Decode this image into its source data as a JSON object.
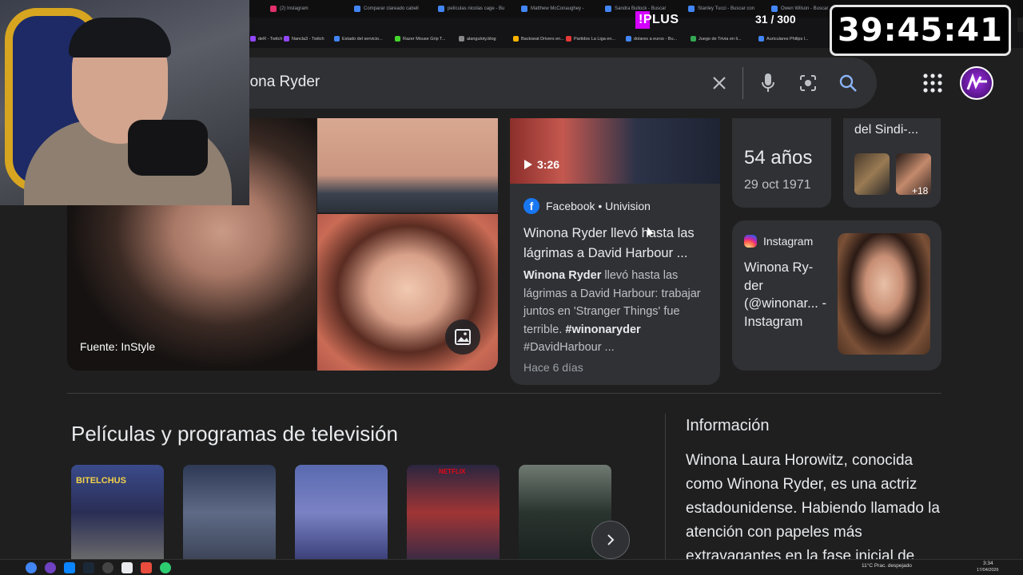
{
  "browser": {
    "tabs": [
      {
        "label": "(2) Instagram",
        "color": "#e1306c"
      },
      {
        "label": "Comparar clareado cabell",
        "color": "#4285f4"
      },
      {
        "label": "películas nicolas cage - Bu",
        "color": "#4285f4"
      },
      {
        "label": "Matthew McConaughey -",
        "color": "#4285f4"
      },
      {
        "label": "Sandra Bullock - Buscar",
        "color": "#4285f4"
      },
      {
        "label": "Stanley Tucci - Buscar con",
        "color": "#4285f4"
      },
      {
        "label": "Owen Wilson - Buscar",
        "color": "#4285f4"
      }
    ],
    "bookmarks": [
      {
        "label": "deR - Twitch",
        "color": "#9146ff"
      },
      {
        "label": "Nancla3 - Twitch",
        "color": "#9146ff"
      },
      {
        "label": "Estado del servicio...",
        "color": "#4285f4"
      },
      {
        "label": "Razer Mouse Grip T...",
        "color": "#44d62c"
      },
      {
        "label": "alanguloty.blog",
        "color": "#888888"
      },
      {
        "label": "Backseat Drivers en...",
        "color": "#ffb300"
      },
      {
        "label": "Partidos La Liga en...",
        "color": "#e53935"
      },
      {
        "label": "dolares a euros - Bu...",
        "color": "#4285f4"
      },
      {
        "label": "Juego de Trivia en li...",
        "color": "#34a853"
      },
      {
        "label": "Auriculares Philips l...",
        "color": "#4285f4"
      }
    ]
  },
  "overlay": {
    "plus_label": "!PLUS",
    "progress": "31 / 300",
    "timer": "39:45:41"
  },
  "search": {
    "query": "nona Ryder",
    "icons": [
      "clear-icon",
      "mic-icon",
      "lens-icon",
      "search-icon"
    ]
  },
  "images": {
    "source_label": "Fuente: InStyle"
  },
  "video_card": {
    "duration": "3:26",
    "source": "Facebook • Univision",
    "title": "Winona Ryder llevó hasta las lágrimas a David Harbour ...",
    "desc_bold": "Winona Ryder",
    "desc_text": " llevó hasta las lágrimas a David Harbour: trabajar juntos en 'Stranger Things' fue terrible. ",
    "desc_tags_bold": "#winonaryder",
    "desc_tags": " #DavidHarbour ...",
    "time": "Hace 6 días"
  },
  "age_card": {
    "age": "54 años",
    "dob": "29 oct 1971"
  },
  "related_card": {
    "title": "del Sindi-...",
    "more": "+18"
  },
  "instagram_card": {
    "source": "Instagram",
    "title": "Winona Ry- der (@winonar... - Instagram"
  },
  "movies": {
    "heading": "Películas y programas de televisión",
    "posters": [
      {
        "label": "BITELCHUS",
        "color": "#2f3b6b"
      },
      {
        "label": "",
        "color": "#3a4660"
      },
      {
        "label": "",
        "color": "#4a4f87"
      },
      {
        "label": "NETFLIX",
        "color": "#5a2a3a"
      },
      {
        "label": "",
        "color": "#2c3a35"
      }
    ]
  },
  "info": {
    "heading": "Información",
    "text": "Winona Laura Horowitz, conocida como Winona Ryder, es una actriz estadounidense. Habiendo llamado la atención con papeles más extravagantes en la fase inicial de"
  },
  "taskbar": {
    "weather": "11°C  Prac. despejado",
    "time": "3:34",
    "date": "17/04/2026"
  }
}
